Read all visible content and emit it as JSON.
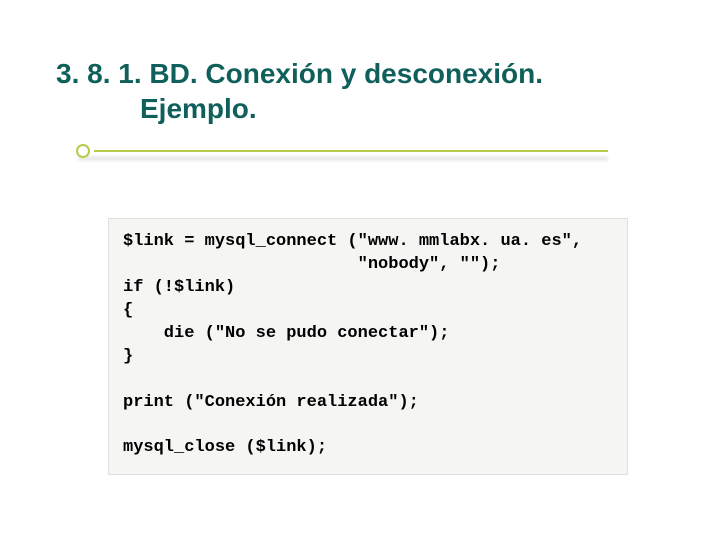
{
  "title_line1": "3. 8. 1. BD. Conexión y desconexión.",
  "title_line2": "Ejemplo.",
  "code": "$link = mysql_connect (\"www. mmlabx. ua. es\",\n                       \"nobody\", \"\");\nif (!$link)\n{\n    die (\"No se pudo conectar\");\n}\n\nprint (\"Conexión realizada\");\n\nmysql_close ($link);"
}
